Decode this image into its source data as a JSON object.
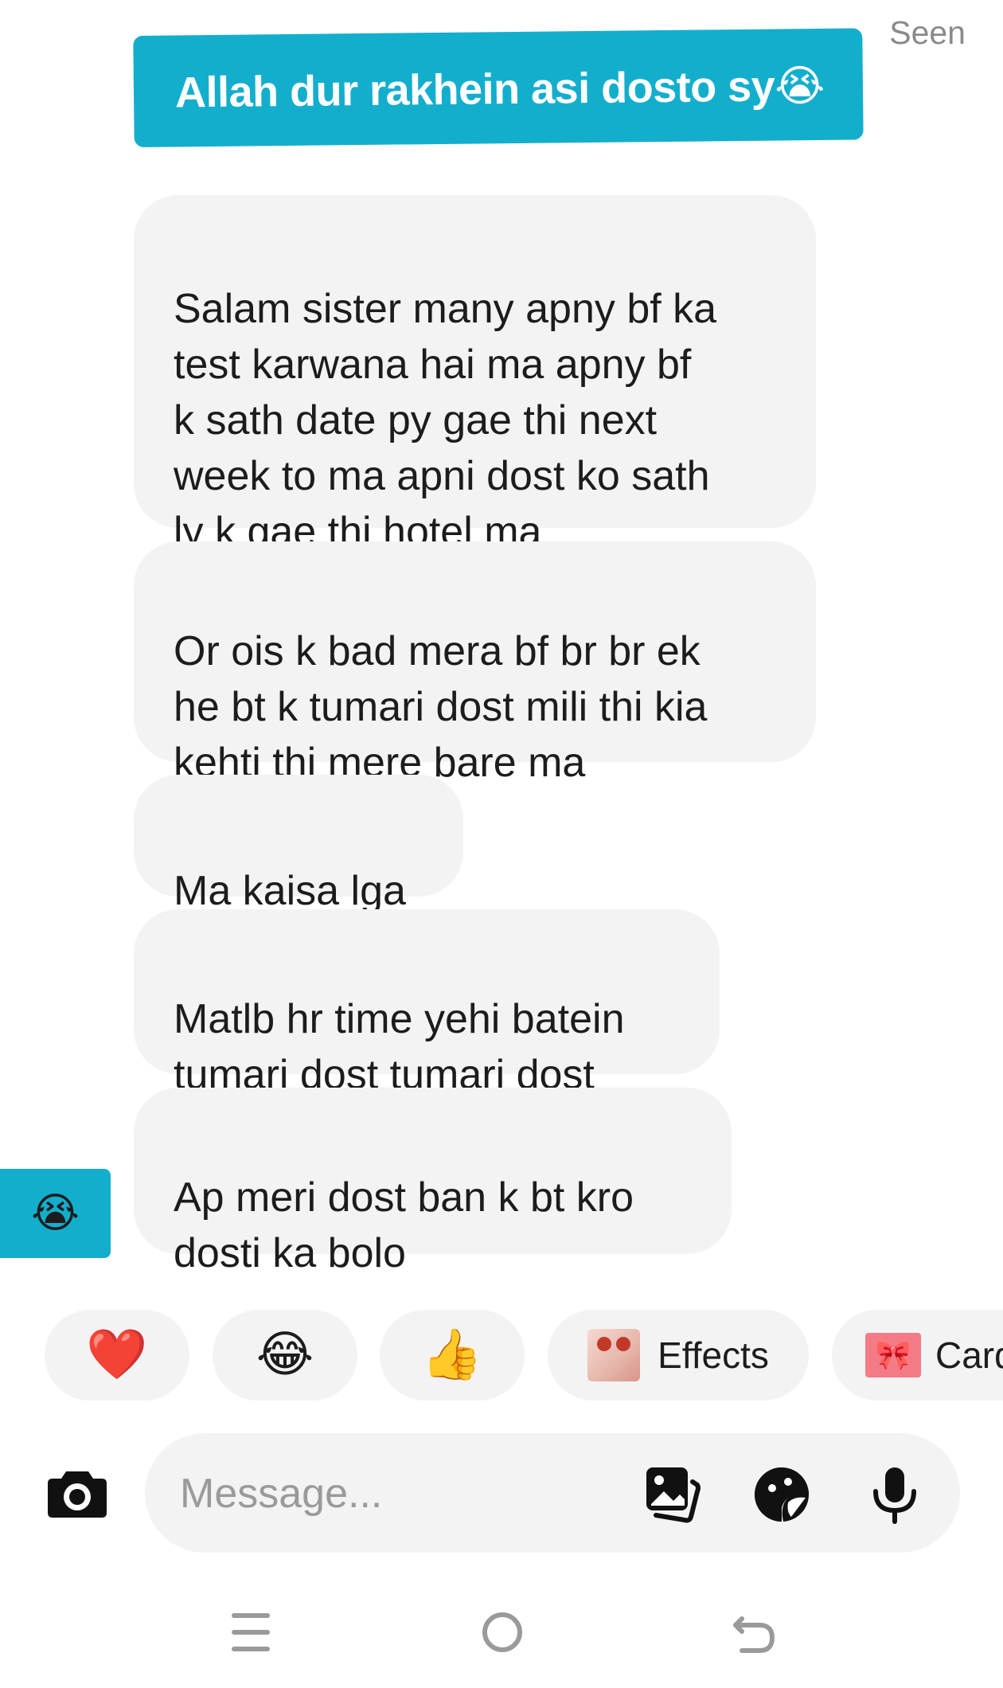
{
  "status": {
    "seen": "Seen"
  },
  "sent_message": {
    "text": "Allah dur rakhein asi dosto sy😭"
  },
  "received_messages": [
    {
      "text": "Salam sister many apny bf ka\ntest karwana hai ma apny bf\nk sath date py gae thi next\nweek to ma apni dost ko sath\nly k gae thi hotel ma"
    },
    {
      "text": "Or ois k bad mera bf br br ek\nhe bt k tumari dost mili thi kia\nkehti thi mere bare ma"
    },
    {
      "text": "Ma kaisa lga"
    },
    {
      "text": "Matlb hr time yehi batein\ntumari dost tumari dost"
    },
    {
      "text": "Ap meri dost ban k bt kro\ndosti ka bolo"
    }
  ],
  "reaction": {
    "emoji": "😭"
  },
  "quick_reactions": [
    {
      "emoji": "❤️"
    },
    {
      "emoji": "😂"
    },
    {
      "emoji": "👍"
    }
  ],
  "chips": {
    "effects_label": "Effects",
    "cards_label": "Card"
  },
  "composer": {
    "placeholder": "Message...",
    "camera_icon": "camera-icon",
    "gallery_icon": "gallery-icon",
    "sticker_icon": "sticker-icon",
    "mic_icon": "microphone-icon"
  },
  "nav": {
    "menu_icon": "menu-icon",
    "home_icon": "home-icon",
    "back_icon": "back-icon"
  },
  "colors": {
    "accent": "#14aecd",
    "bubble": "#f3f3f3",
    "text": "#1c1c1c",
    "muted": "#8a8a8a"
  }
}
